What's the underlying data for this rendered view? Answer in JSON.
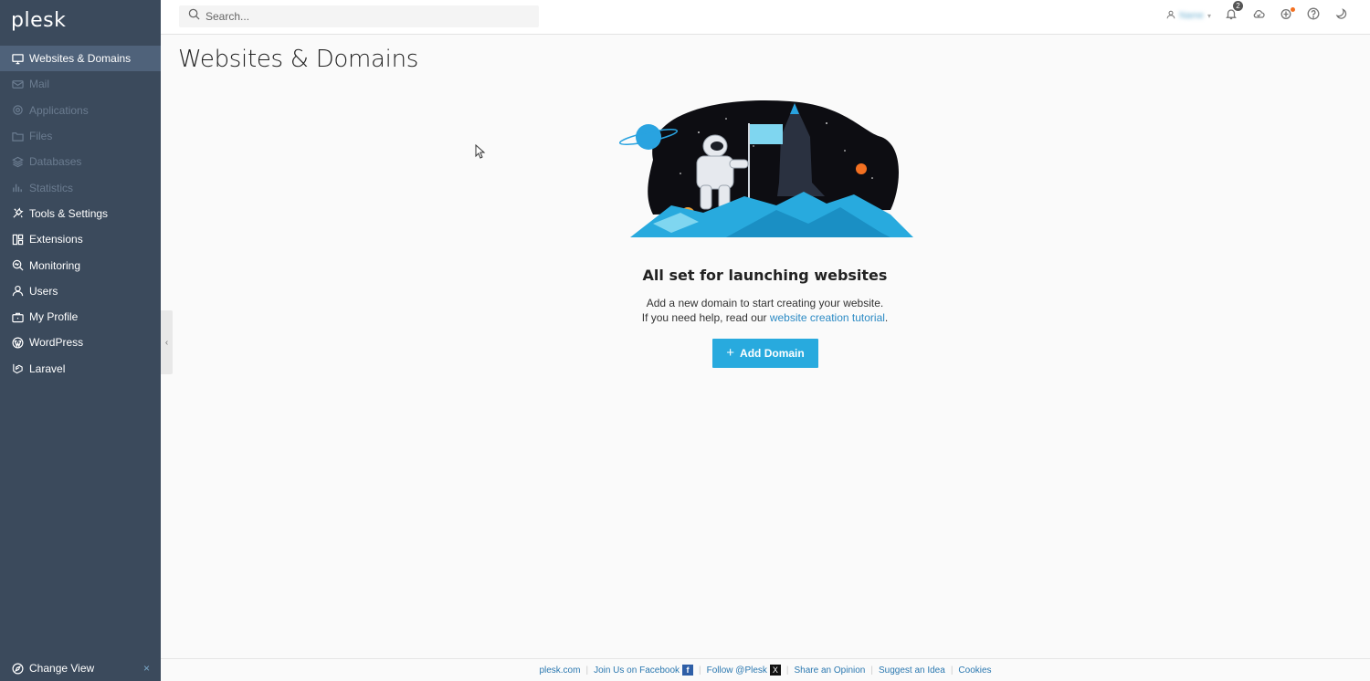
{
  "app": {
    "logo": "plesk"
  },
  "sidebar": {
    "items": [
      {
        "label": "Websites & Domains",
        "icon": "monitor-icon",
        "active": true,
        "dim": false
      },
      {
        "label": "Mail",
        "icon": "mail-icon",
        "active": false,
        "dim": true
      },
      {
        "label": "Applications",
        "icon": "gear-icon",
        "active": false,
        "dim": true
      },
      {
        "label": "Files",
        "icon": "folder-icon",
        "active": false,
        "dim": true
      },
      {
        "label": "Databases",
        "icon": "database-icon",
        "active": false,
        "dim": true
      },
      {
        "label": "Statistics",
        "icon": "bar-chart-icon",
        "active": false,
        "dim": true
      },
      {
        "label": "Tools & Settings",
        "icon": "tools-icon",
        "active": false,
        "dim": false
      },
      {
        "label": "Extensions",
        "icon": "extensions-icon",
        "active": false,
        "dim": false
      },
      {
        "label": "Monitoring",
        "icon": "monitoring-icon",
        "active": false,
        "dim": false
      },
      {
        "label": "Users",
        "icon": "user-icon",
        "active": false,
        "dim": false
      },
      {
        "label": "My Profile",
        "icon": "briefcase-icon",
        "active": false,
        "dim": false
      },
      {
        "label": "WordPress",
        "icon": "wordpress-icon",
        "active": false,
        "dim": false
      },
      {
        "label": "Laravel",
        "icon": "laravel-icon",
        "active": false,
        "dim": false
      }
    ],
    "change_view": "Change View",
    "change_view_close": "×"
  },
  "topbar": {
    "search_placeholder": "Search...",
    "user_name": "Name",
    "notifications_count": "2"
  },
  "main": {
    "title": "Websites & Domains",
    "empty_title": "All set for launching websites",
    "empty_line1": "Add a new domain to start creating your website.",
    "empty_line2_prefix": "If you need help, read our ",
    "empty_link": "website creation tutorial",
    "empty_line2_suffix": ".",
    "add_button": "Add Domain"
  },
  "footer": {
    "links": [
      "plesk.com",
      "Join Us on Facebook",
      "Follow @Plesk",
      "Share an Opinion",
      "Suggest an Idea",
      "Cookies"
    ]
  },
  "colors": {
    "sidebar_bg": "#3b4a5c",
    "sidebar_active": "#4f627a",
    "accent": "#28aade",
    "link": "#2b8ac4"
  }
}
